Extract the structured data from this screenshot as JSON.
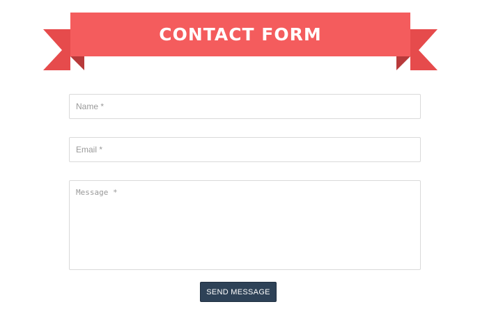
{
  "banner": {
    "title": "CONTACT FORM"
  },
  "form": {
    "name_placeholder": "Name *",
    "email_placeholder": "Email *",
    "message_placeholder": "Message *",
    "send_label": "SEND MESSAGE"
  },
  "colors": {
    "ribbon": "#f45c5d",
    "ribbon_tail": "#e64b4c",
    "ribbon_fold": "#b83a3b",
    "button": "#2e4257"
  }
}
